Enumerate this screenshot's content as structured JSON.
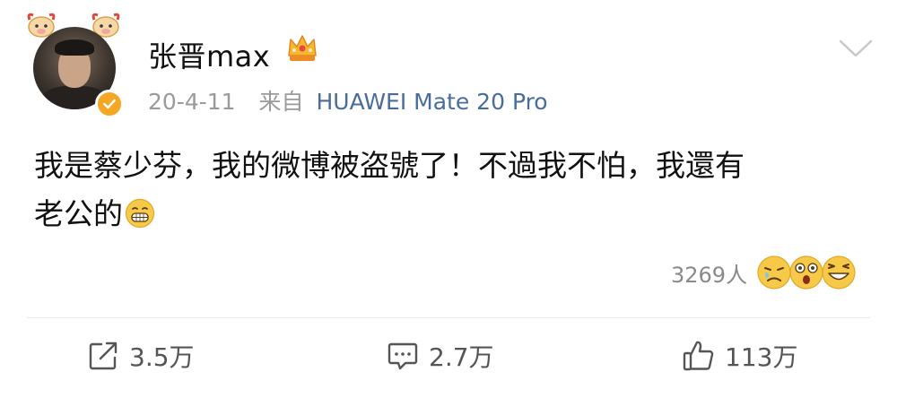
{
  "post": {
    "username": "张晋max",
    "date": "20-4-11",
    "source_prefix": "来自",
    "device": "HUAWEI Mate 20 Pro",
    "content_line1": "我是蔡少芬，我的微博被盗號了！不過我不怕，我還有",
    "content_line2": "老公的",
    "reaction_count": "3269人"
  },
  "actions": {
    "repost": "3.5万",
    "comment": "2.7万",
    "like": "113万"
  },
  "icons": {
    "verified": "verified-badge-icon",
    "crown": "crown-icon",
    "more": "chevron-down-icon",
    "grin_emoji": "grinning-emoji-icon",
    "repost": "repost-icon",
    "comment": "comment-icon",
    "like": "thumbs-up-icon"
  },
  "colors": {
    "link_blue": "#4a6c9a",
    "meta_gray": "#9a9a9a",
    "verified_orange": "#f5a623",
    "emoji_yellow": "#f7c948"
  }
}
